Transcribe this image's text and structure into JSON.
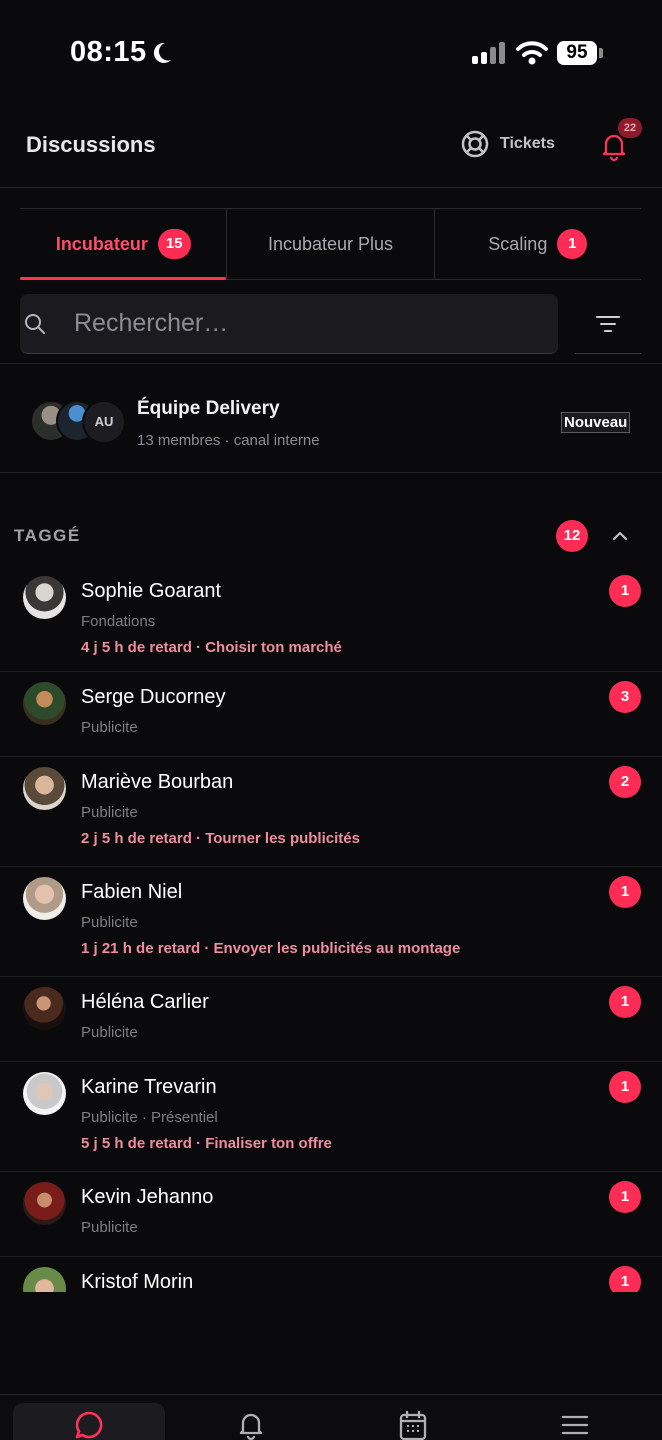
{
  "status_bar": {
    "time": "08:15",
    "battery": "95"
  },
  "header": {
    "title": "Discussions",
    "tickets_label": "Tickets",
    "notifications_count": "22"
  },
  "tabs": [
    {
      "label": "Incubateur",
      "badge": "15",
      "active": true
    },
    {
      "label": "Incubateur Plus",
      "badge": "",
      "active": false
    },
    {
      "label": "Scaling",
      "badge": "1",
      "active": false
    }
  ],
  "search": {
    "placeholder": "Rechercher…"
  },
  "channel": {
    "name": "Équipe Delivery",
    "meta": "13 membres · canal interne",
    "avatar_initials": "AU",
    "badge": "Nouveau"
  },
  "section": {
    "title": "TAGGÉ",
    "count": "12"
  },
  "conversations": [
    {
      "name": "Sophie Goarant",
      "sub": "Fondations",
      "late": "4 j 5 h de retard · Choisir ton marché",
      "count": "1"
    },
    {
      "name": "Serge Ducorney",
      "sub": "Publicite",
      "late": "",
      "count": "3"
    },
    {
      "name": "Mariève Bourban",
      "sub": "Publicite",
      "late": "2 j 5 h de retard · Tourner les publicités",
      "count": "2"
    },
    {
      "name": "Fabien Niel",
      "sub": "Publicite",
      "late": "1 j 21 h de retard · Envoyer les publicités au montage",
      "count": "1"
    },
    {
      "name": "Héléna Carlier",
      "sub": "Publicite",
      "late": "",
      "count": "1"
    },
    {
      "name": "Karine Trevarin",
      "sub": "Publicite · Présentiel",
      "late": "5 j 5 h de retard · Finaliser ton offre",
      "count": "1"
    },
    {
      "name": "Kevin Jehanno",
      "sub": "Publicite",
      "late": "",
      "count": "1"
    },
    {
      "name": "Kristof Morin",
      "sub": "",
      "late": "",
      "count": "1"
    }
  ],
  "colors": {
    "accent": "#ff2d55",
    "late_text": "#f08ca0",
    "background": "#0a0a0d"
  },
  "bottom_nav": [
    {
      "icon": "chat-icon",
      "active": true
    },
    {
      "icon": "bell-icon",
      "active": false
    },
    {
      "icon": "calendar-icon",
      "active": false
    },
    {
      "icon": "menu-icon",
      "active": false
    }
  ]
}
